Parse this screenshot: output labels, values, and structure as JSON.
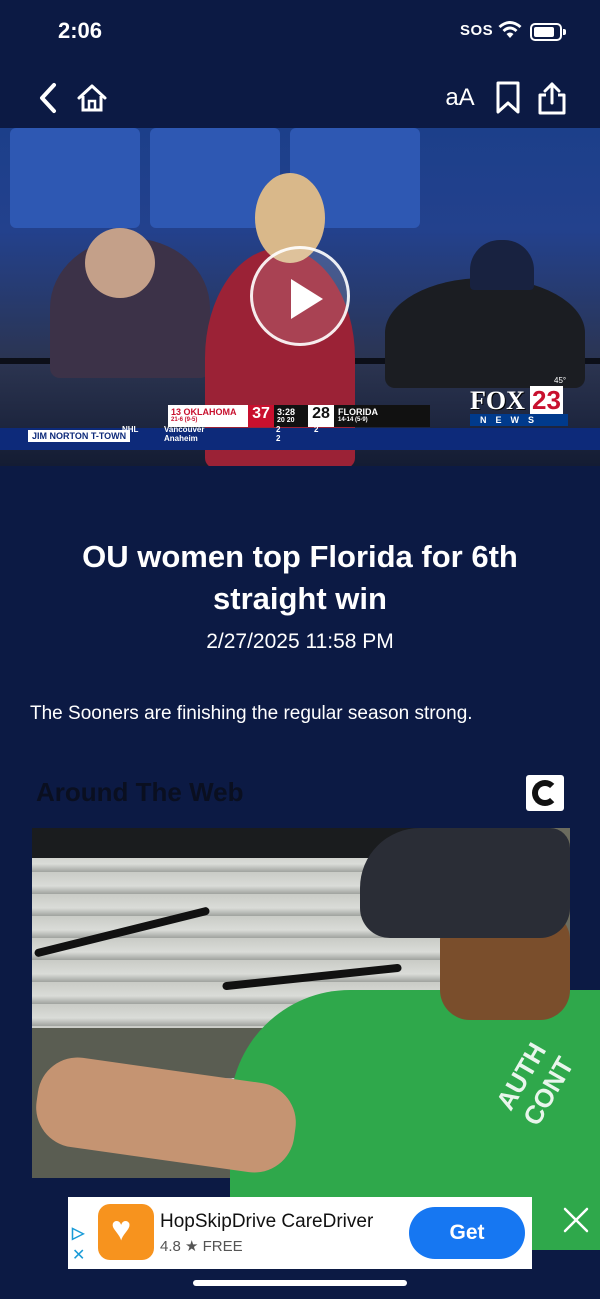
{
  "status_bar": {
    "time": "2:06",
    "carrier": "SOS",
    "icons": [
      "wifi-icon",
      "battery-icon"
    ]
  },
  "nav": {
    "back_icon": "chevron-left-icon",
    "home_icon": "home-icon",
    "text_size_label": "aA",
    "bookmark_icon": "bookmark-icon",
    "share_icon": "share-icon"
  },
  "video": {
    "play_icon": "play-icon",
    "scorebug": {
      "team1": "13 OKLAHOMA",
      "team1_record": "21-6 (9-5)",
      "score1": "37",
      "clock": "3:28",
      "clock_sub": "20 20",
      "score2": "28",
      "team2": "FLORIDA",
      "team2_record": "14-14 (5-9)"
    },
    "ticker": {
      "sponsor": "JIM NORTON T-TOWN",
      "league": "NHL",
      "team_a": "Vancouver",
      "team_b": "Anaheim",
      "score_a": "2",
      "score_b": "2",
      "period": "2"
    },
    "station": {
      "brand": "FOX",
      "number": "23",
      "sub": "NEWS",
      "temp": "45°"
    }
  },
  "article": {
    "title": "OU women top Florida for 6th straight win",
    "date": "2/27/2025 11:58 PM",
    "summary": "The Sooners are finishing the regular season strong."
  },
  "around_the_web": {
    "heading": "Around The Web",
    "badge_icon": "outbrain-logo-icon",
    "shirt_text": "AUTH CONT"
  },
  "ad": {
    "choices_icon": "adchoices-icon",
    "app_icon": "hopskipdrive-heart-icon",
    "title": "HopSkipDrive CareDriver",
    "rating": "4.8 ★ FREE",
    "cta": "Get",
    "close_icon": "close-icon"
  },
  "colors": {
    "background": "#0c1a44",
    "accent_blue": "#1677f2",
    "scorebug_red": "#c8102e"
  }
}
